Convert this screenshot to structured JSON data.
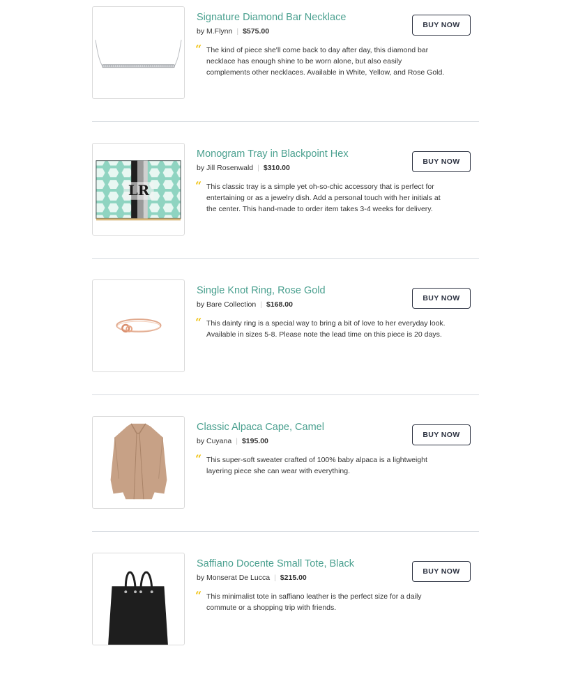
{
  "products": [
    {
      "title": "Signature Diamond Bar Necklace",
      "by": "by M.Flynn",
      "price": "$575.00",
      "quote": "“",
      "description": "The kind of piece she'll come back to day after day, this diamond bar necklace has enough shine to be worn alone, but also easily complements other necklaces. Available in White, Yellow, and Rose Gold.",
      "button": "BUY NOW",
      "image": "necklace-image"
    },
    {
      "title": "Monogram Tray in Blackpoint Hex",
      "by": "by Jill Rosenwald",
      "price": "$310.00",
      "quote": "“",
      "description": "This classic tray is a simple yet oh-so-chic accessory that is perfect for entertaining or as a jewelry dish. Add a personal touch with her initials at the center. This hand-made to order item takes 3-4 weeks for delivery.",
      "button": "BUY NOW",
      "image": "tray-image",
      "monogram": "LR"
    },
    {
      "title": "Single Knot Ring, Rose Gold",
      "by": "by Bare Collection",
      "price": "$168.00",
      "quote": "“",
      "description": "This dainty ring is a special way to bring a bit of love to her everyday look. Available in sizes 5-8. Please note the lead time on this piece is 20 days.",
      "button": "BUY NOW",
      "image": "ring-image"
    },
    {
      "title": "Classic Alpaca Cape, Camel",
      "by": "by Cuyana",
      "price": "$195.00",
      "quote": "“",
      "description": "This super-soft sweater crafted of 100% baby alpaca is a lightweight layering piece she can wear with everything.",
      "button": "BUY NOW",
      "image": "cape-image"
    },
    {
      "title": "Saffiano Docente Small Tote, Black",
      "by": "by Monserat De Lucca",
      "price": "$215.00",
      "quote": "“",
      "description": "This minimalist tote in saffiano leather is the perfect size for a daily commute or a shopping trip with friends.",
      "button": "BUY NOW",
      "image": "tote-image"
    }
  ],
  "colors": {
    "title": "#4aa08f",
    "quote": "#f0c419",
    "button_border": "#2b3140",
    "divider": "#d6dbe0"
  }
}
